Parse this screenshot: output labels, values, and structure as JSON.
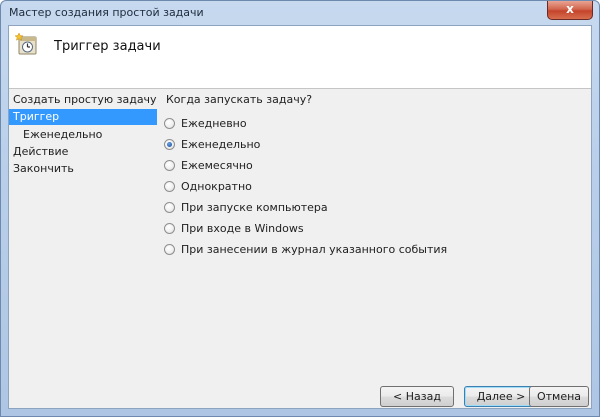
{
  "window": {
    "title": "Мастер создания простой задачи",
    "close_glyph": "x"
  },
  "header": {
    "icon": "task-scheduler-icon",
    "title": "Триггер задачи"
  },
  "nav": {
    "items": [
      {
        "label": "Создать простую задачу",
        "selected": false,
        "sub": false
      },
      {
        "label": "Триггер",
        "selected": true,
        "sub": false
      },
      {
        "label": "Еженедельно",
        "selected": false,
        "sub": true
      },
      {
        "label": "Действие",
        "selected": false,
        "sub": false
      },
      {
        "label": "Закончить",
        "selected": false,
        "sub": false
      }
    ]
  },
  "content": {
    "question": "Когда запускать задачу?",
    "options": [
      {
        "label": "Ежедневно",
        "checked": false
      },
      {
        "label": "Еженедельно",
        "checked": true
      },
      {
        "label": "Ежемесячно",
        "checked": false
      },
      {
        "label": "Однократно",
        "checked": false
      },
      {
        "label": "При запуске компьютера",
        "checked": false
      },
      {
        "label": "При входе в Windows",
        "checked": false
      },
      {
        "label": "При занесении в журнал указанного события",
        "checked": false
      }
    ]
  },
  "buttons": {
    "back": "< Назад",
    "next": "Далее >",
    "cancel": "Отмена"
  }
}
